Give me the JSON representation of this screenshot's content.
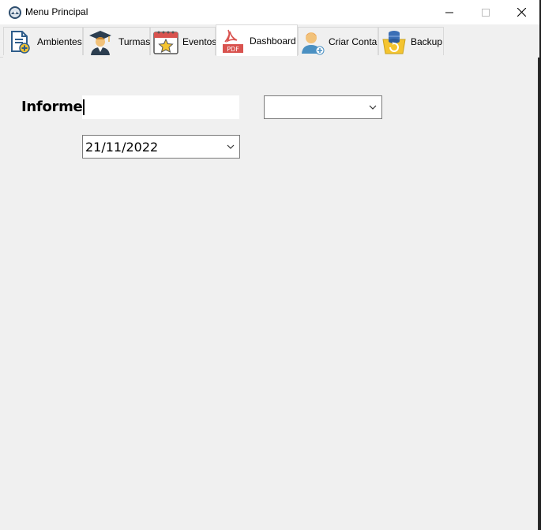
{
  "window": {
    "title": "Menu Principal"
  },
  "tabs": [
    {
      "label": "Ambientes",
      "icon": "document-add-icon",
      "active": false
    },
    {
      "label": "Turmas",
      "icon": "graduate-icon",
      "active": false
    },
    {
      "label": "Eventos",
      "icon": "calendar-star-icon",
      "active": false
    },
    {
      "label": "Dashboard",
      "icon": "pdf-icon",
      "active": true
    },
    {
      "label": "Criar Conta",
      "icon": "user-add-icon",
      "active": false
    },
    {
      "label": "Backup",
      "icon": "database-backup-icon",
      "active": false
    }
  ],
  "form": {
    "informe_label": "Informe:",
    "informe_value": "",
    "type_select_value": "",
    "date_value": "21/11/2022"
  }
}
